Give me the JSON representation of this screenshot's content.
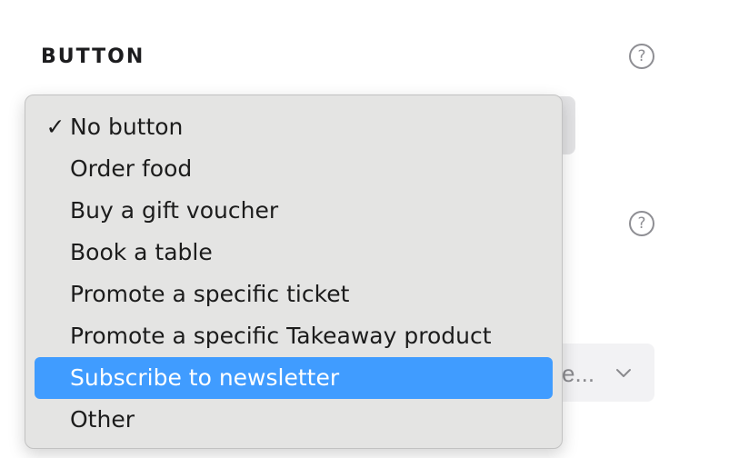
{
  "section": {
    "heading": "BUTTON",
    "help_glyph": "?",
    "second_help_glyph": "?"
  },
  "background_select": {
    "truncated_value": "e...",
    "chevron_icon": "chevron-down-icon"
  },
  "dropdown": {
    "selected_index": 0,
    "highlighted_index": 6,
    "check_glyph": "✓",
    "options": [
      {
        "label": "No button",
        "check": "✓"
      },
      {
        "label": "Order food",
        "check": ""
      },
      {
        "label": "Buy a gift voucher",
        "check": ""
      },
      {
        "label": "Book a table",
        "check": ""
      },
      {
        "label": "Promote a specific ticket",
        "check": ""
      },
      {
        "label": "Promote a specific Takeaway product",
        "check": ""
      },
      {
        "label": "Subscribe to newsletter",
        "check": ""
      },
      {
        "label": "Other",
        "check": ""
      }
    ]
  },
  "colors": {
    "highlight": "#409cff",
    "menu_background": "#e4e4e3",
    "help_icon": "#8e8e93"
  }
}
